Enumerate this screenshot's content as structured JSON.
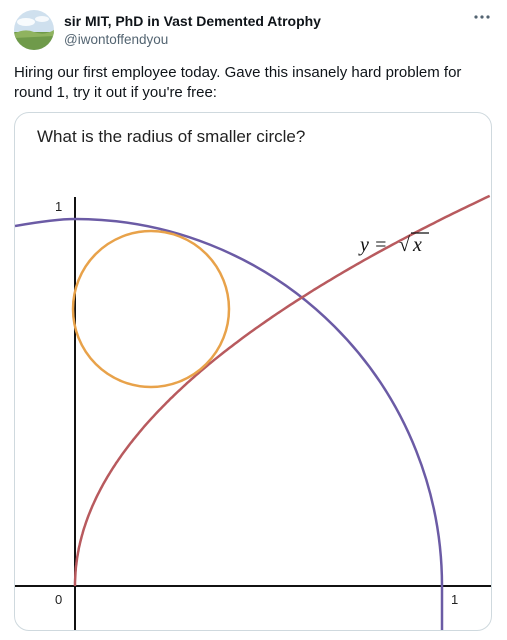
{
  "author": {
    "name": "sir MIT, PhD in Vast Demented Atrophy",
    "handle": "@iwontoffendyou",
    "avatar_icon": "landscape-avatar-icon"
  },
  "more_icon": "more-options-icon",
  "tweet": {
    "text": "Hiring our first employee today. Gave this insanely hard problem for round 1, try it out if you're free:"
  },
  "figure": {
    "title": "What is the radius of smaller circle?",
    "label_y_one": "1",
    "label_origin": "0",
    "label_x_one": "1",
    "curve_label_lhs": "y = ",
    "curve_label_sqrt": "√",
    "curve_label_var": "x",
    "colors": {
      "big_circle": "#6b5ba5",
      "sqrt_curve": "#b85a5e",
      "small_circle": "#e8a24a",
      "axes": "#111111"
    }
  }
}
